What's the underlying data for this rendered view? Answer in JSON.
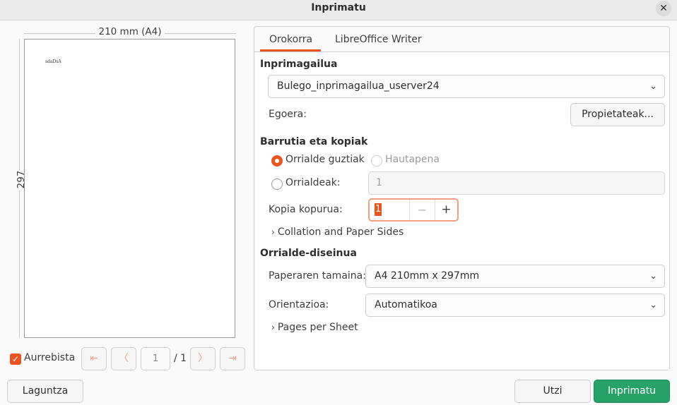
{
  "window": {
    "title": "Inprimatu",
    "close_icon": "close-icon"
  },
  "preview": {
    "width_label": "210 mm (A4)",
    "height_label": "297 mm",
    "page_text": "sdaDsA",
    "show_preview_label": "Aurrebista",
    "show_preview_checked": true,
    "page_number": "1",
    "page_total": "/ 1"
  },
  "tabs": [
    {
      "label": "Orokorra",
      "active": true
    },
    {
      "label": "LibreOffice Writer",
      "active": false
    }
  ],
  "printer": {
    "heading": "Inprimagailua",
    "selected": "Bulego_inprimagailua_userver24",
    "status_label": "Egoera:",
    "properties_button": "Propietateak..."
  },
  "range": {
    "heading": "Barrutia eta kopiak",
    "all_pages_label": "Orrialde guztiak",
    "selection_label": "Hautapena",
    "pages_label": "Orrialdeak:",
    "pages_value": "1",
    "copies_label": "Kopia kopurua:",
    "copies_value": "1",
    "collation_label": "Collation and Paper Sides"
  },
  "layout": {
    "heading": "Orrialde-diseinua",
    "paper_size_label": "Paperaren tamaina:",
    "paper_size_value": "A4 210mm x 297mm",
    "orientation_label": "Orientazioa:",
    "orientation_value": "Automatikoa",
    "pages_per_sheet_label": "Pages per Sheet"
  },
  "buttons": {
    "help": "Laguntza",
    "cancel": "Utzi",
    "print": "Inprimatu"
  },
  "colors": {
    "accent": "#e95420",
    "primary": "#26a269"
  }
}
